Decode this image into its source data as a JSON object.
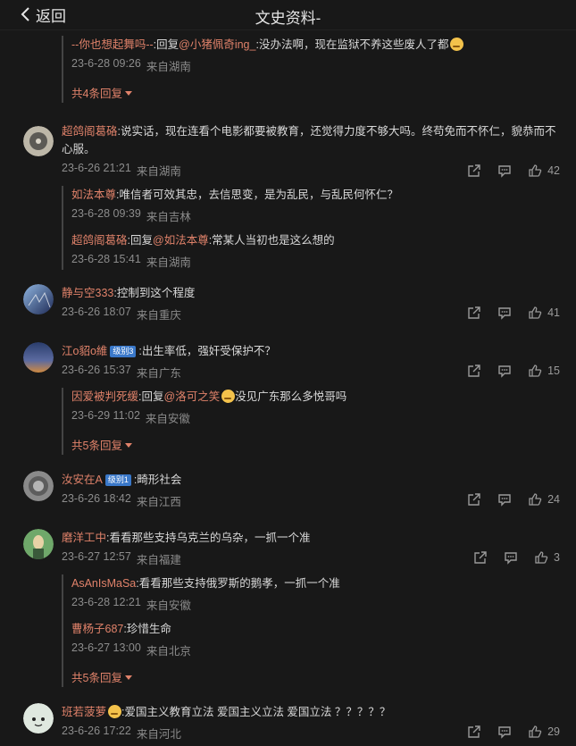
{
  "header": {
    "back_label": "返回",
    "title": "文史资料-"
  },
  "c0": {
    "reply1": {
      "user": "--你也想起舞吗--",
      "sep": ":回复",
      "mention": "@小猪佩奇ing_",
      "text": ":没办法啊，现在监狱不养这些废人了都",
      "time": "23-6-28 09:26",
      "loc": "来自湖南"
    },
    "more": "共4条回复"
  },
  "c1": {
    "user": "超鸽阁葛硌",
    "text": ":说实话，现在连看个电影都要被教育，还觉得力度不够大吗。终苟免而不怀仁，貌恭而不心服。",
    "time": "23-6-26 21:21",
    "loc": "来自湖南",
    "likes": "42",
    "reply1": {
      "user": "如法本尊",
      "text": ":唯信者可效其忠，去信思变，是为乱民，与乱民何怀仁？",
      "time": "23-6-28 09:39",
      "loc": "来自吉林"
    },
    "reply2": {
      "user": "超鸽阁葛硌",
      "sep": ":回复",
      "mention": "@如法本尊",
      "text": ":常某人当初也是这么想的",
      "time": "23-6-28 15:41",
      "loc": "来自湖南"
    }
  },
  "c2": {
    "user": "静与空333",
    "text": ":控制到这个程度",
    "time": "23-6-26 18:07",
    "loc": "来自重庆",
    "likes": "41"
  },
  "c3": {
    "user": "江o貂o維",
    "badge": "级别3",
    "text": ":出生率低，强奸受保护不？",
    "time": "23-6-26 15:37",
    "loc": "来自广东",
    "likes": "15",
    "reply1": {
      "user": "因爱被判死缓",
      "sep": ":回复",
      "mention": "@洛可之笑",
      "text": "没见广东那么多悦哥吗",
      "time": "23-6-29 11:02",
      "loc": "来自安徽"
    },
    "more": "共5条回复"
  },
  "c4": {
    "user": "汝安在A",
    "badge": "级别1",
    "text": ":畸形社会",
    "time": "23-6-26 18:42",
    "loc": "来自江西",
    "likes": "24"
  },
  "c5": {
    "user": "磨洋工中",
    "text": ":看看那些支持乌克兰的乌杂，一抓一个准",
    "time": "23-6-27 12:57",
    "loc": "来自福建",
    "likes": "3",
    "reply1": {
      "user": "AsAnIsMaSa",
      "text": ":看看那些支持俄罗斯的鹅孝，一抓一个准",
      "time": "23-6-28 12:21",
      "loc": "来自安徽"
    },
    "reply2": {
      "user": "曹杨子687",
      "text": ":珍惜生命",
      "time": "23-6-27 13:00",
      "loc": "来自北京"
    },
    "more": "共5条回复"
  },
  "c6": {
    "user": "班若菠萝",
    "text": ":爱国主义教育立法   爱国主义立法   爱国立法   ？？？？？",
    "time": "23-6-26 17:22",
    "loc": "来自河北",
    "likes": "29"
  }
}
